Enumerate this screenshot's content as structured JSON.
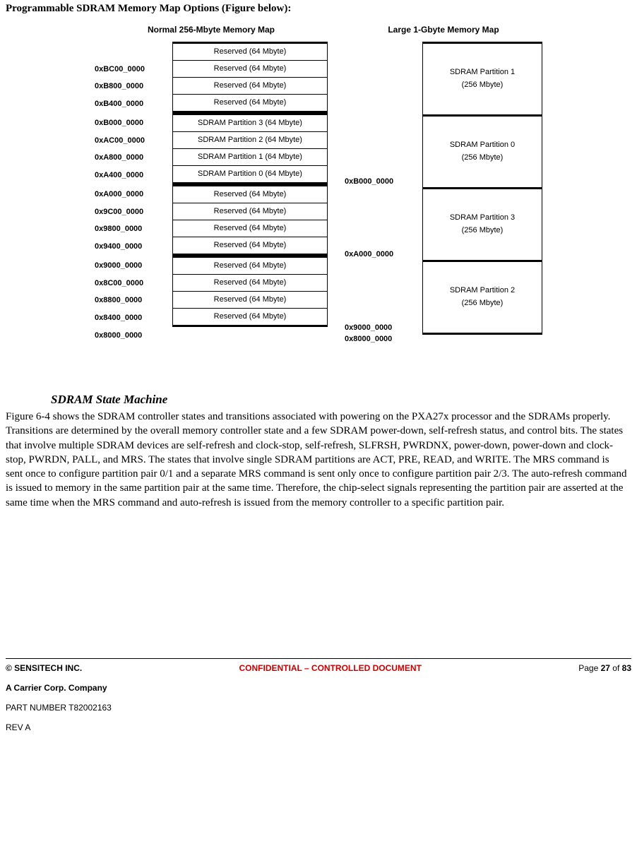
{
  "title": "Programmable SDRAM Memory Map Options (Figure below):",
  "figure": {
    "left_title": "Normal 256-Mbyte Memory Map",
    "right_title": "Large 1-Gbyte Memory Map",
    "left": [
      {
        "addr": "",
        "cell": "Reserved (64 Mbyte)"
      },
      {
        "addr": "0xBC00_0000",
        "cell": "Reserved (64 Mbyte)"
      },
      {
        "addr": "0xB800_0000",
        "cell": "Reserved (64 Mbyte)"
      },
      {
        "addr": "0xB400_0000",
        "cell": "Reserved (64 Mbyte)"
      },
      {
        "addr": "0xB000_0000",
        "cell": "SDRAM Partition 3 (64 Mbyte)"
      },
      {
        "addr": "0xAC00_0000",
        "cell": "SDRAM Partition 2 (64 Mbyte)"
      },
      {
        "addr": "0xA800_0000",
        "cell": "SDRAM Partition 1 (64 Mbyte)"
      },
      {
        "addr": "0xA400_0000",
        "cell": "SDRAM Partition 0 (64 Mbyte)"
      },
      {
        "addr": "0xA000_0000",
        "cell": "Reserved (64 Mbyte)"
      },
      {
        "addr": "0x9C00_0000",
        "cell": "Reserved (64 Mbyte)"
      },
      {
        "addr": "0x9800_0000",
        "cell": "Reserved (64 Mbyte)"
      },
      {
        "addr": "0x9400_0000",
        "cell": "Reserved (64 Mbyte)"
      },
      {
        "addr": "0x9000_0000",
        "cell": "Reserved (64 Mbyte)"
      },
      {
        "addr": "0x8C00_0000",
        "cell": "Reserved (64 Mbyte)"
      },
      {
        "addr": "0x8800_0000",
        "cell": "Reserved (64 Mbyte)"
      },
      {
        "addr": "0x8400_0000",
        "cell": "Reserved (64 Mbyte)"
      }
    ],
    "left_last_addr": "0x8000_0000",
    "right": [
      {
        "addr": "",
        "label": "SDRAM Partition 1",
        "size": "(256 Mbyte)"
      },
      {
        "addr": "0xB000_0000",
        "label": "SDRAM Partition 0",
        "size": "(256 Mbyte)"
      },
      {
        "addr": "0xA000_0000",
        "label": "SDRAM Partition 3",
        "size": "(256 Mbyte)"
      },
      {
        "addr": "0x9000_0000",
        "label": "SDRAM Partition 2",
        "size": "(256 Mbyte)"
      }
    ],
    "right_last_addr": "0x8000_0000"
  },
  "subhead": "SDRAM State Machine",
  "body": "Figure 6-4 shows the SDRAM controller states and transitions associated with powering on the PXA27x processor and the SDRAMs properly. Transitions are determined by the overall memory controller state and a few SDRAM power-down, self-refresh status, and control bits. The states that involve multiple SDRAM devices are self-refresh and clock-stop, self-refresh, SLFRSH, PWRDNX, power-down, power-down and clock-stop, PWRDN, PALL, and MRS. The states that involve single SDRAM partitions are ACT, PRE, READ, and WRITE. The MRS command is sent once to configure partition pair 0/1 and a separate MRS command is sent only once to configure partition pair 2/3. The auto-refresh command is issued to memory in the same partition pair at the same time. Therefore, the chip-select signals representing the partition pair are asserted at the same time when the MRS command and auto-refresh is issued from the memory controller to a specific partition pair.",
  "footer": {
    "copyright": "© SENSITECH INC.",
    "confidential": "CONFIDENTIAL – CONTROLLED DOCUMENT",
    "page_label": "Page ",
    "page_current": "27",
    "page_of": " of ",
    "page_total": "83",
    "company": "A Carrier Corp. Company",
    "partnum": "PART NUMBER T82002163",
    "rev": "REV A"
  }
}
